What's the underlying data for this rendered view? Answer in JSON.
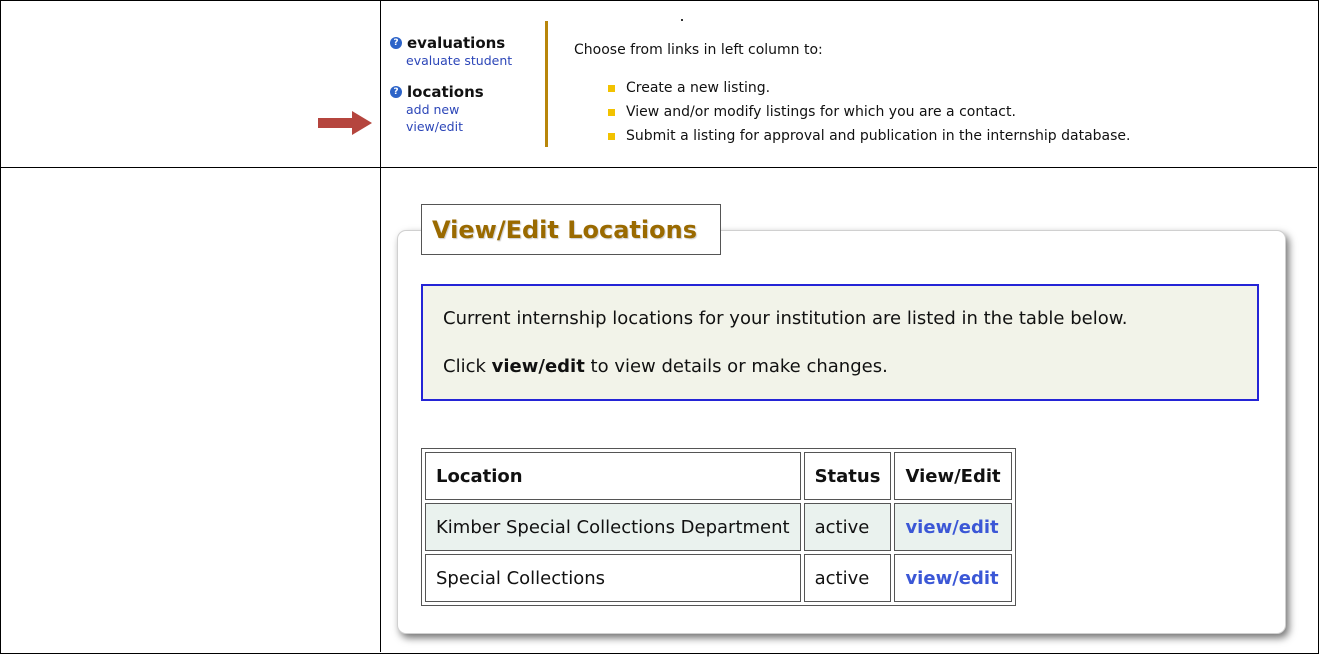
{
  "nav": {
    "groups": [
      {
        "title": "evaluations",
        "links": [
          "evaluate student"
        ]
      },
      {
        "title": "locations",
        "links": [
          "add new",
          "view/edit"
        ]
      }
    ]
  },
  "intro": {
    "text": "Choose from links in left column to:",
    "bullets": [
      "Create a new listing.",
      "View and/or modify listings for which you are a contact.",
      "Submit a listing for approval and publication in the internship database."
    ]
  },
  "panel": {
    "title": "View/Edit Locations",
    "info_line1": "Current internship locations for your institution are listed in the table below.",
    "info_line2_prefix": "Click ",
    "info_line2_bold": "view/edit",
    "info_line2_suffix": " to view details or make changes."
  },
  "table": {
    "headers": [
      "Location",
      "Status",
      "View/Edit"
    ],
    "rows": [
      {
        "location": "Kimber Special Collections Department",
        "status": "active",
        "action": "view/edit"
      },
      {
        "location": "Special Collections",
        "status": "active",
        "action": "view/edit"
      }
    ]
  },
  "icons": {
    "help": "help-icon",
    "arrow": "arrow-right-icon",
    "bullet": "square-bullet-icon"
  },
  "colors": {
    "accent_gold": "#b8860b",
    "title_gold": "#9a6a00",
    "link_blue": "#2c46b8",
    "info_border": "#2424d6",
    "arrow_red": "#b5453e"
  }
}
